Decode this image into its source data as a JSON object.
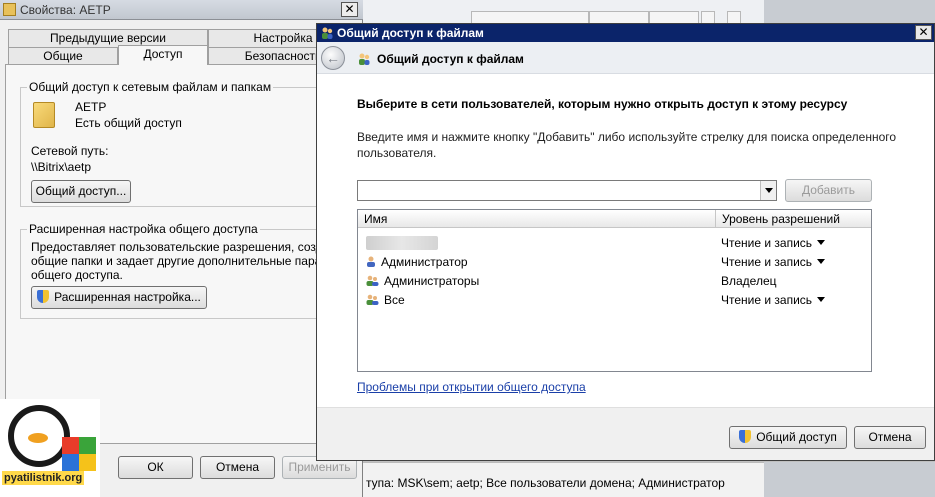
{
  "props_window": {
    "title": "Свойства: AETP",
    "tabs_back": [
      "Предыдущие версии",
      "Настройка"
    ],
    "tabs_front": [
      "Общие",
      "Доступ",
      "Безопасность"
    ],
    "group_share": {
      "title": "Общий доступ к сетевым файлам и папкам",
      "folder_name": "AETP",
      "folder_status": "Есть общий доступ",
      "path_label": "Сетевой путь:",
      "path_value": "\\\\Bitrix\\aetp",
      "share_button": "Общий доступ..."
    },
    "group_advanced": {
      "title": "Расширенная настройка общего доступа",
      "desc_lines": [
        "Предоставляет пользовательские разрешения, создает",
        "общие папки и задает другие дополнительные парамет",
        "общего доступа."
      ],
      "button": "Расширенная настройка..."
    },
    "buttons": {
      "ok": "ОК",
      "cancel": "Отмена",
      "apply": "Применить"
    }
  },
  "logo": {
    "text": "pyatilistnik.org"
  },
  "background_status": "тупа: MSK\\sem; aetp; Все пользователи домена; Администратор",
  "share_dialog": {
    "title": "Общий доступ к файлам",
    "nav_title": "Общий доступ к файлам",
    "heading": "Выберите в сети пользователей, которым нужно открыть доступ к этому ресурсу",
    "description": "Введите имя и нажмите кнопку \"Добавить\" либо используйте стрелку для поиска определенного пользователя.",
    "input_value": "",
    "add_button": "Добавить",
    "columns": {
      "name": "Имя",
      "permission": "Уровень разрешений"
    },
    "rows": [
      {
        "name": "",
        "permission": "Чтение и запись",
        "has_menu": true
      },
      {
        "name": "Администратор",
        "permission": "Чтение и запись",
        "has_menu": true
      },
      {
        "name": "Администраторы",
        "permission": "Владелец",
        "has_menu": false
      },
      {
        "name": "Все",
        "permission": "Чтение и запись",
        "has_menu": true
      }
    ],
    "help_link": "Проблемы при открытии общего доступа",
    "share_button": "Общий доступ",
    "cancel_button": "Отмена"
  }
}
